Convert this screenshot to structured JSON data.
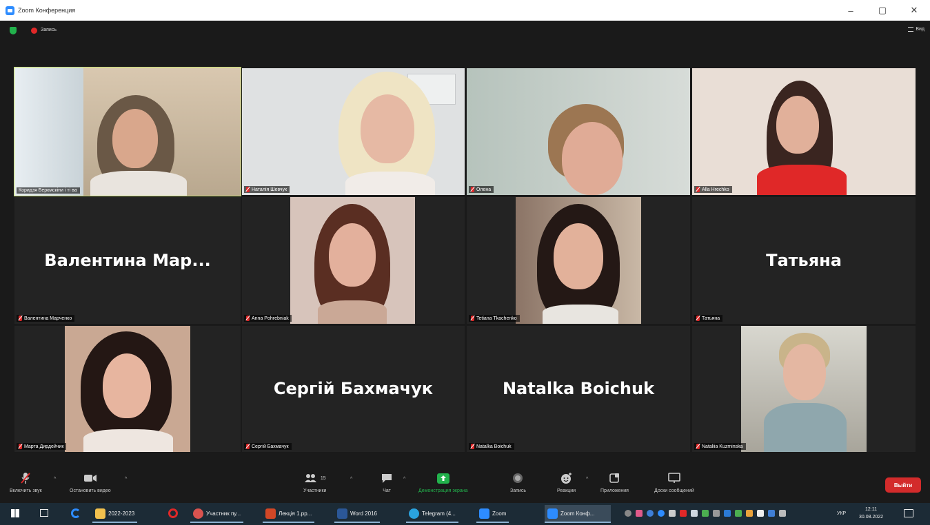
{
  "window": {
    "title": "Zoom Конференция"
  },
  "topbar": {
    "recording_label": "Запись",
    "view_label": "Вид"
  },
  "tiles": [
    {
      "name": "Коридзя Беркмскіни і ті ва"
    },
    {
      "name": "Наталія Шевчук"
    },
    {
      "name": "Олена"
    },
    {
      "name": "Alla Hrechko"
    },
    {
      "name": "Валентина Марченко",
      "display": "Валентина  Мар..."
    },
    {
      "name": "Anna Pohrebniak"
    },
    {
      "name": "Tetiana Tkachenko"
    },
    {
      "name": "Татьяна",
      "display": "Татьяна"
    },
    {
      "name": "Марта Дирдейчик"
    },
    {
      "name": "Сергій Бахмачук",
      "display": "Сергій Бахмачук"
    },
    {
      "name": "Natalka Boichuk",
      "display": "Natalka Boichuk"
    },
    {
      "name": "Nataliia Kuzminska"
    }
  ],
  "toolbar": {
    "audio": "Включить звук",
    "video": "Остановить видео",
    "participants": "Участники",
    "participants_count": "15",
    "chat": "Чат",
    "share": "Демонстрация экрана",
    "record": "Запись",
    "reactions": "Реакции",
    "apps": "Приложения",
    "whiteboards": "Доски сообщений",
    "leave": "Выйти"
  },
  "taskbar": {
    "items": [
      {
        "label": "2022-2023"
      },
      {
        "label": "Участник пу..."
      },
      {
        "label": "Лекція 1.рр..."
      },
      {
        "label": "Word 2016"
      },
      {
        "label": "Telegram (4..."
      },
      {
        "label": "Zoom"
      },
      {
        "label": "Zoom Конф..."
      }
    ],
    "language": "УКР",
    "time": "12:11",
    "date": "30.08.2022"
  },
  "colors": {
    "active_speaker": "#c7e06a",
    "leave": "#d32b2b",
    "share": "#22b24c",
    "muted": "#e02828"
  }
}
